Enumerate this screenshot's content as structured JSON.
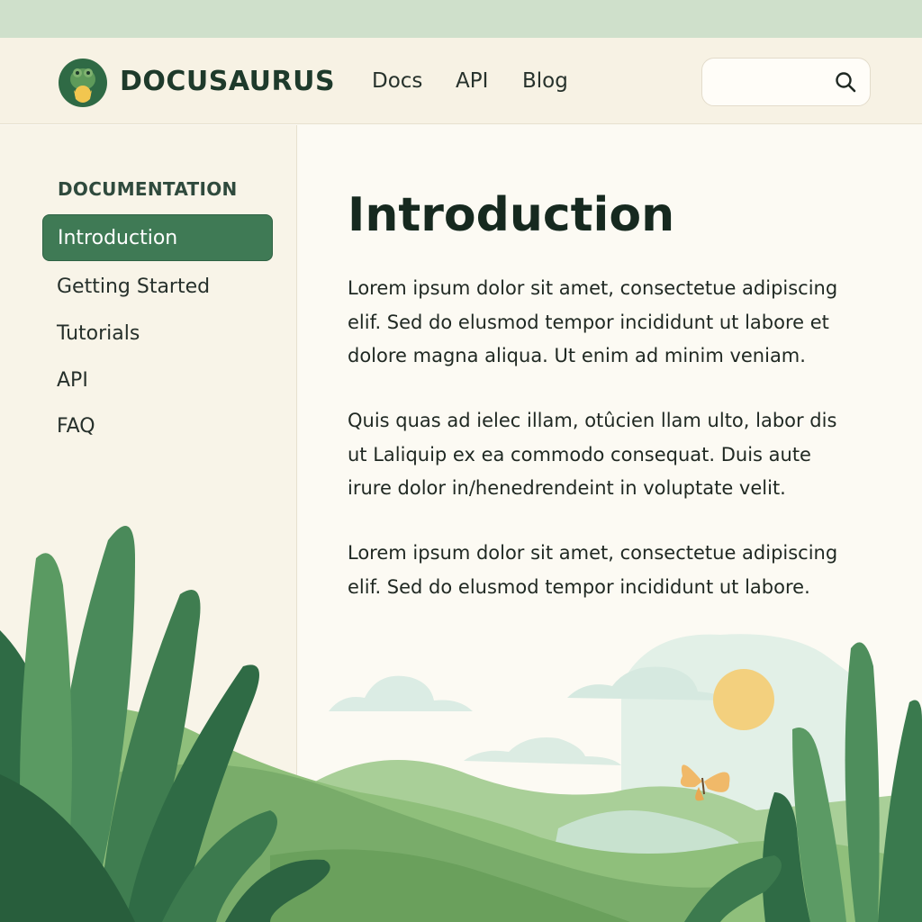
{
  "header": {
    "brand": "DOCUSAURUS",
    "nav": [
      "Docs",
      "API",
      "Blog"
    ],
    "search": {
      "placeholder": "",
      "icon": "search-icon"
    }
  },
  "sidebar": {
    "heading": "DOCUMENTATION",
    "items": [
      {
        "label": "Introduction",
        "active": true
      },
      {
        "label": "Getting Started",
        "active": false
      },
      {
        "label": "Tutorials",
        "active": false
      },
      {
        "label": "API",
        "active": false
      },
      {
        "label": "FAQ",
        "active": false
      }
    ]
  },
  "main": {
    "title": "Introduction",
    "paragraphs": [
      "Lorem ipsum dolor sit amet, consectetue adipiscing elif. Sed do elusmod tempor incididunt ut labore et dolore magna aliqua. Ut enim ad minim veniam.",
      "Quis quas ad ielec illam, otûcien llam ulto, labor dis ut Laliquip ex ea commodo consequat. Duis aute irure dolor in/henedrendeint in voluptate velit.",
      "Lorem ipsum dolor sit amet, consectetue adipiscing elif. Sed do elusmod tempor incididunt ut labore."
    ]
  },
  "colors": {
    "accent": "#3f7a55",
    "topstrip": "#cfe0cb",
    "navbar": "#f7f2e4",
    "text": "#1f2822"
  }
}
